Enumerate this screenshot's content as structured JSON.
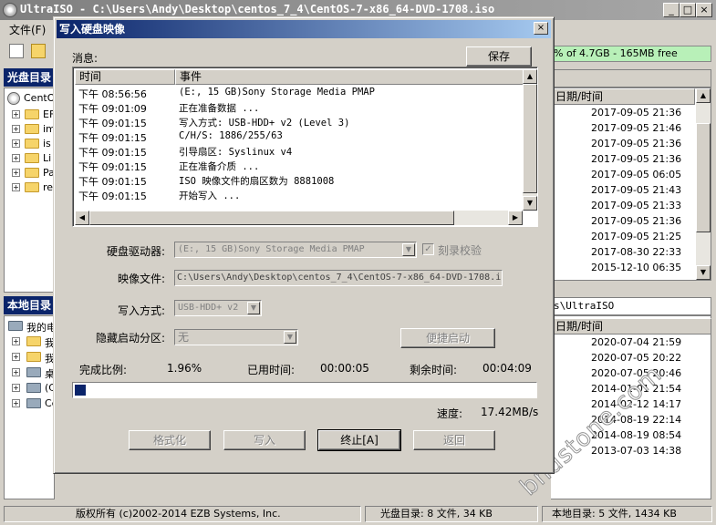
{
  "main_window": {
    "title": "UltraISO - C:\\Users\\Andy\\Desktop\\centos_7_4\\CentOS-7-x86_64-DVD-1708.iso",
    "menu_first": "文件(F)",
    "capacity_text": "% of 4.7GB - 165MB free",
    "iso_pane": {
      "header": "光盘目录",
      "root": "CentO",
      "folders": [
        "EF",
        "im",
        "is",
        "Li",
        "Pa",
        "re"
      ],
      "date_col": "日期/时间",
      "dates": [
        "2017-09-05 21:36",
        "2017-09-05 21:46",
        "2017-09-05 21:36",
        "2017-09-05 21:36",
        "2017-09-05 06:05",
        "2017-09-05 21:43",
        "2017-09-05 21:33",
        "2017-09-05 21:36",
        "2017-09-05 21:25",
        "2017-08-30 22:33",
        "2015-12-10 06:35"
      ]
    },
    "local_pane": {
      "header": "本地目录",
      "path_suffix": "s\\UltraISO",
      "tree": [
        "我的电",
        "我",
        "我",
        "桌",
        "(C",
        "Ce"
      ],
      "date_col": "日期/时间",
      "dates": [
        "2020-07-04 21:59",
        "2020-07-05 20:22",
        "2020-07-05 20:46",
        "2014-01-01 21:54",
        "2014-02-12 14:17",
        "2014-08-19 22:14",
        "2014-08-19 08:54",
        "2013-07-03 14:38"
      ]
    },
    "status": {
      "copyright": "版权所有 (c)2002-2014 EZB Systems, Inc.",
      "iso_info": "光盘目录: 8 文件, 34 KB",
      "local_info": "本地目录: 5 文件, 1434 KB"
    }
  },
  "dialog": {
    "title": "写入硬盘映像",
    "close": "×",
    "messages_label": "消息:",
    "save_button": "保存",
    "log_headers": {
      "time": "时间",
      "event": "事件"
    },
    "log": [
      {
        "time": "下午 08:56:56",
        "event": "(E:, 15 GB)Sony    Storage Media   PMAP"
      },
      {
        "time": "下午 09:01:09",
        "event": "正在准备数据 ..."
      },
      {
        "time": "下午 09:01:15",
        "event": "写入方式: USB-HDD+ v2 (Level 3)"
      },
      {
        "time": "下午 09:01:15",
        "event": "C/H/S: 1886/255/63"
      },
      {
        "time": "下午 09:01:15",
        "event": "引导扇区: Syslinux v4"
      },
      {
        "time": "下午 09:01:15",
        "event": "正在准备介质 ..."
      },
      {
        "time": "下午 09:01:15",
        "event": "ISO 映像文件的扇区数为 8881008"
      },
      {
        "time": "下午 09:01:15",
        "event": "开始写入 ..."
      }
    ],
    "drive_label": "硬盘驱动器:",
    "drive_value": "(E:, 15 GB)Sony    Storage Media   PMAP",
    "verify_label": "刻录校验",
    "image_label": "映像文件:",
    "image_value": "C:\\Users\\Andy\\Desktop\\centos_7_4\\CentOS-7-x86_64-DVD-1708.i",
    "write_mode_label": "写入方式:",
    "write_mode_value": "USB-HDD+ v2",
    "hidden_part_label": "隐藏启动分区:",
    "hidden_part_value": "无",
    "boot_button": "便捷启动",
    "progress_label": "完成比例:",
    "progress_value": "1.96%",
    "progress_fraction": 0.0196,
    "elapsed_label": "已用时间:",
    "elapsed_value": "00:00:05",
    "remaining_label": "剩余时间:",
    "remaining_value": "00:04:09",
    "speed_label": "速度:",
    "speed_value": "17.42MB/s",
    "buttons": {
      "format": "格式化",
      "write": "写入",
      "stop": "终止[A]",
      "back": "返回"
    }
  },
  "watermark": "bndstone.com"
}
